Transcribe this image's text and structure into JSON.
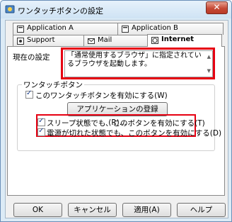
{
  "window": {
    "title": "ワンタッチボタンの設定",
    "close_glyph": "✕"
  },
  "tabs": [
    {
      "label": "Application A",
      "icon": "application-icon"
    },
    {
      "label": "Application B",
      "icon": "application-icon"
    },
    {
      "label": "Support",
      "icon": "support-icon"
    },
    {
      "label": "Mail",
      "icon": "mail-icon"
    },
    {
      "label": "Internet",
      "icon": "internet-icon"
    }
  ],
  "settings": {
    "current_label": "現在の設定",
    "current_text": "「通常使用するブラウザ」に指定されているブラウザを起動します。",
    "group_label": "ワンタッチボタン",
    "enable_label": "このワンタッチボタンを有効にする(W)",
    "register_app_button": "アプリケーションの登録(R)...",
    "sleep_label": "スリープ状態でも、このボタンを有効にする(T)",
    "poweroff_label": "電源が切れた状態でも、このボタンを有効にする(D)"
  },
  "checkboxes": {
    "enable": true,
    "sleep": true,
    "poweroff": true
  },
  "footer": {
    "ok": "OK",
    "cancel": "キャンセル",
    "apply": "適用(A)",
    "help": "ヘルプ"
  },
  "colors": {
    "highlight": "#e60012",
    "title_gradient_top": "#e6f1fb"
  }
}
